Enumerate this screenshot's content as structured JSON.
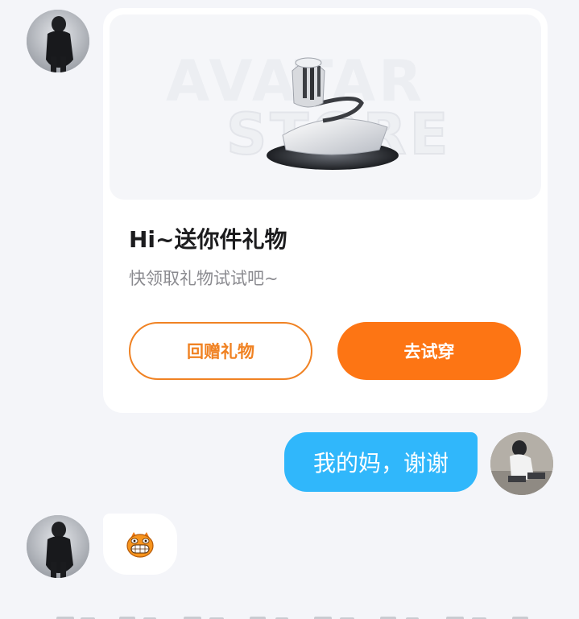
{
  "gift_card": {
    "title": "Hi~送你件礼物",
    "subtitle": "快领取礼物试试吧~",
    "banner_text_1": "AVATAR",
    "banner_text_2": "STORE",
    "return_gift_label": "回赠礼物",
    "try_on_label": "去试穿"
  },
  "messages": {
    "outgoing_text": "我的妈，谢谢"
  },
  "emoji": {
    "name": "grinning-orange-face-icon"
  },
  "colors": {
    "accent_orange": "#fd7514",
    "outgoing_bubble": "#30b7fb",
    "background": "#f4f5f9"
  }
}
